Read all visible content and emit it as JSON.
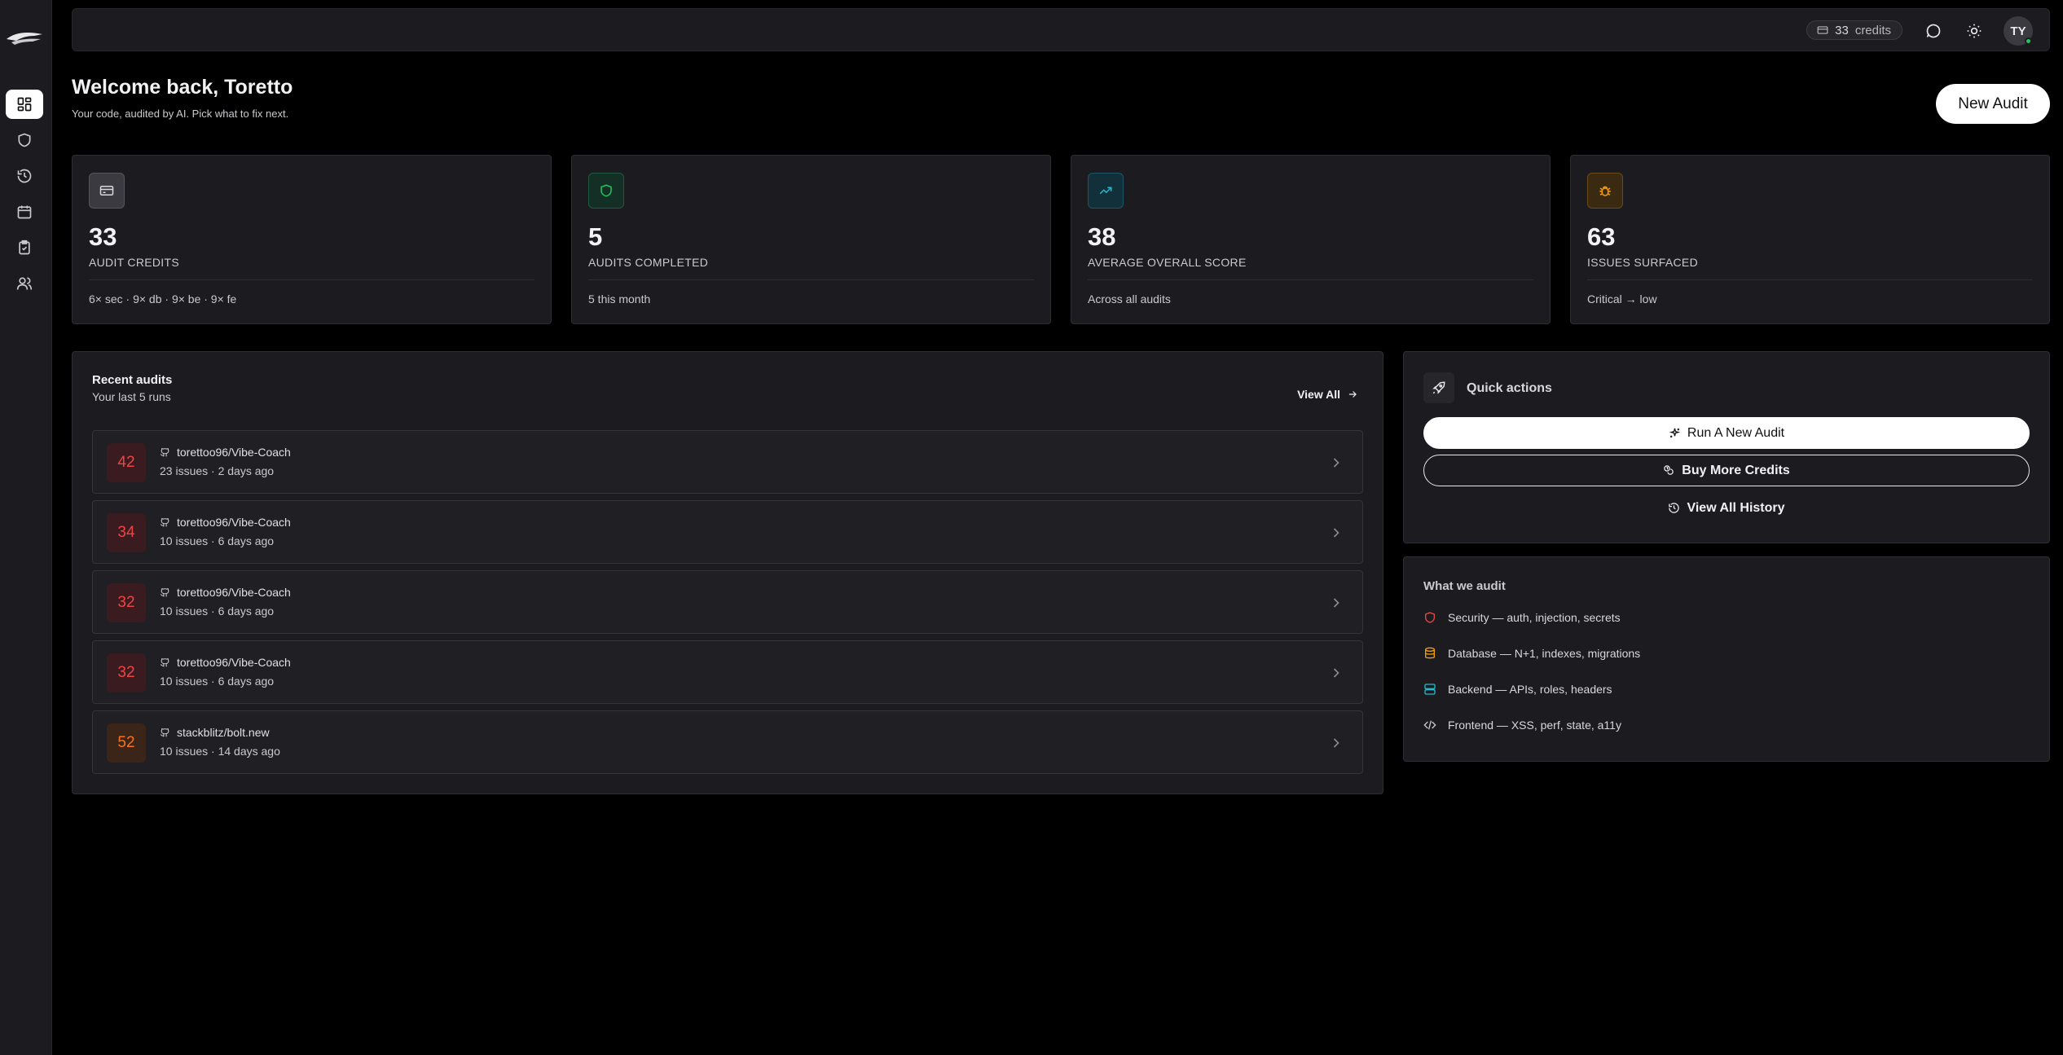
{
  "topbar": {
    "credits_count": "33",
    "credits_label": "credits",
    "avatar_initials": "TY"
  },
  "header": {
    "welcome": "Welcome back, Toretto",
    "subtitle": "Your code, audited by AI. Pick what to fix next.",
    "new_audit_label": "New Audit"
  },
  "stats": [
    {
      "value": "33",
      "label": "AUDIT CREDITS",
      "foot": "6× sec · 9× db · 9× be · 9× fe",
      "icon": "card-icon",
      "color": "#9a9aa0"
    },
    {
      "value": "5",
      "label": "AUDITS COMPLETED",
      "foot": "5 this month",
      "icon": "shield-icon",
      "color": "#22c55e"
    },
    {
      "value": "38",
      "label": "AVERAGE OVERALL SCORE",
      "foot": "Across all audits",
      "icon": "trending-up-icon",
      "color": "#22b8cf"
    },
    {
      "value": "63",
      "label": "ISSUES SURFACED",
      "foot": "Critical → low",
      "icon": "bug-icon",
      "color": "#f59e0b"
    }
  ],
  "recent": {
    "title": "Recent audits",
    "subtitle": "Your last 5 runs",
    "view_all": "View All",
    "rows": [
      {
        "score": "42",
        "repo": "torettoo96/Vibe-Coach",
        "meta": "23 issues · 2 days ago",
        "tone": "red"
      },
      {
        "score": "34",
        "repo": "torettoo96/Vibe-Coach",
        "meta": "10 issues · 6 days ago",
        "tone": "red"
      },
      {
        "score": "32",
        "repo": "torettoo96/Vibe-Coach",
        "meta": "10 issues · 6 days ago",
        "tone": "red"
      },
      {
        "score": "32",
        "repo": "torettoo96/Vibe-Coach",
        "meta": "10 issues · 6 days ago",
        "tone": "red"
      },
      {
        "score": "52",
        "repo": "stackblitz/bolt.new",
        "meta": "10 issues · 14 days ago",
        "tone": "orange"
      }
    ]
  },
  "quick_actions": {
    "title": "Quick actions",
    "run_new": "Run A New Audit",
    "buy_credits": "Buy More Credits",
    "view_history": "View All History"
  },
  "what_we_audit": {
    "title": "What we audit",
    "items": [
      {
        "text": "Security — auth, injection, secrets",
        "icon": "shield-icon",
        "color": "#ef4444"
      },
      {
        "text": "Database — N+1, indexes, migrations",
        "icon": "database-icon",
        "color": "#f59e0b"
      },
      {
        "text": "Backend — APIs, roles, headers",
        "icon": "server-icon",
        "color": "#22b8cf"
      },
      {
        "text": "Frontend — XSS, perf, state, a11y",
        "icon": "code-icon",
        "color": "#c9c9ce"
      }
    ]
  }
}
